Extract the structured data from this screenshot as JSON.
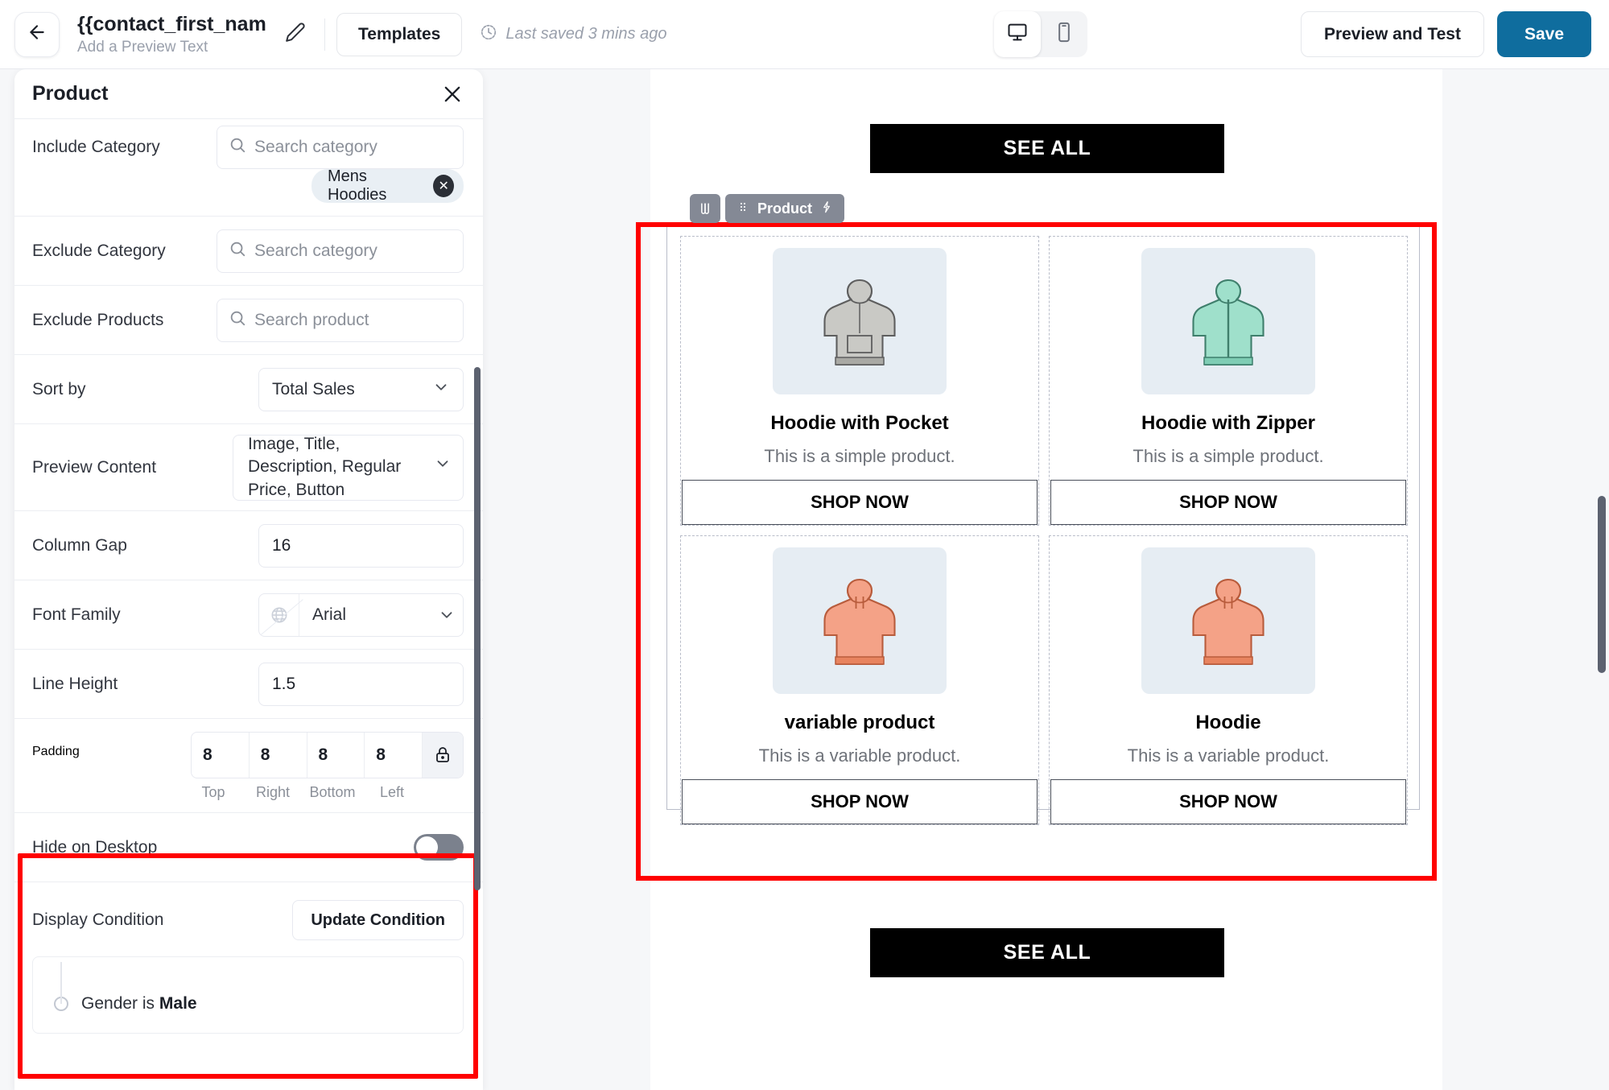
{
  "header": {
    "back_icon": "arrow-left-icon",
    "title": "{{contact_first_nam…",
    "subtitle": "Add a Preview Text",
    "edit_icon": "pencil-icon",
    "templates_label": "Templates",
    "saved_icon": "clock-icon",
    "saved_label": "Last saved 3 mins ago",
    "desktop_icon": "desktop-icon",
    "mobile_icon": "mobile-icon",
    "preview_label": "Preview and Test",
    "save_label": "Save",
    "save_color": "#0f6d9e"
  },
  "panel": {
    "title": "Product",
    "close_icon": "close-icon",
    "rows": {
      "include_category": {
        "label": "Include Category",
        "placeholder": "Search category",
        "chip": "Mens Hoodies",
        "chip_remove_icon": "close-circle-icon"
      },
      "exclude_category": {
        "label": "Exclude Category",
        "placeholder": "Search category"
      },
      "exclude_products": {
        "label": "Exclude Products",
        "placeholder": "Search product"
      },
      "sort_by": {
        "label": "Sort by",
        "value": "Total Sales"
      },
      "preview_content": {
        "label": "Preview Content",
        "value": "Image, Title, Description, Regular Price, Button"
      },
      "column_gap": {
        "label": "Column Gap",
        "value": "16"
      },
      "font_family": {
        "label": "Font Family",
        "value": "Arial",
        "icon": "globe-icon"
      },
      "line_height": {
        "label": "Line Height",
        "value": "1.5"
      },
      "padding": {
        "label": "Padding",
        "values": [
          "8",
          "8",
          "8",
          "8"
        ],
        "sides": [
          "Top",
          "Right",
          "Bottom",
          "Left"
        ],
        "lock_icon": "lock-icon"
      },
      "hide_on_desktop": {
        "label": "Hide on Desktop",
        "enabled": false
      },
      "display_condition": {
        "label": "Display Condition",
        "button_label": "Update Condition",
        "condition_prefix": "Gender is ",
        "condition_value": "Male"
      }
    }
  },
  "email": {
    "see_all_top": "SEE ALL",
    "see_all_bottom": "SEE ALL",
    "block_badge": {
      "handle_icon": "drag-columns-icon",
      "grip_icon": "grip-dots-icon",
      "label": "Product",
      "bolt_icon": "lightning-icon"
    },
    "products": [
      {
        "title": "Hoodie with Pocket",
        "description": "This is a simple product.",
        "button": "SHOP NOW",
        "color": "#c9c9c5"
      },
      {
        "title": "Hoodie with Zipper",
        "description": "This is a simple product.",
        "button": "SHOP NOW",
        "color": "#9fe0cb"
      },
      {
        "title": "variable product",
        "description": "This is a variable product.",
        "button": "SHOP NOW",
        "color": "#f4a287"
      },
      {
        "title": "Hoodie",
        "description": "This is a variable product.",
        "button": "SHOP NOW",
        "color": "#f4a287"
      }
    ]
  },
  "highlight_color": "#ff0000"
}
